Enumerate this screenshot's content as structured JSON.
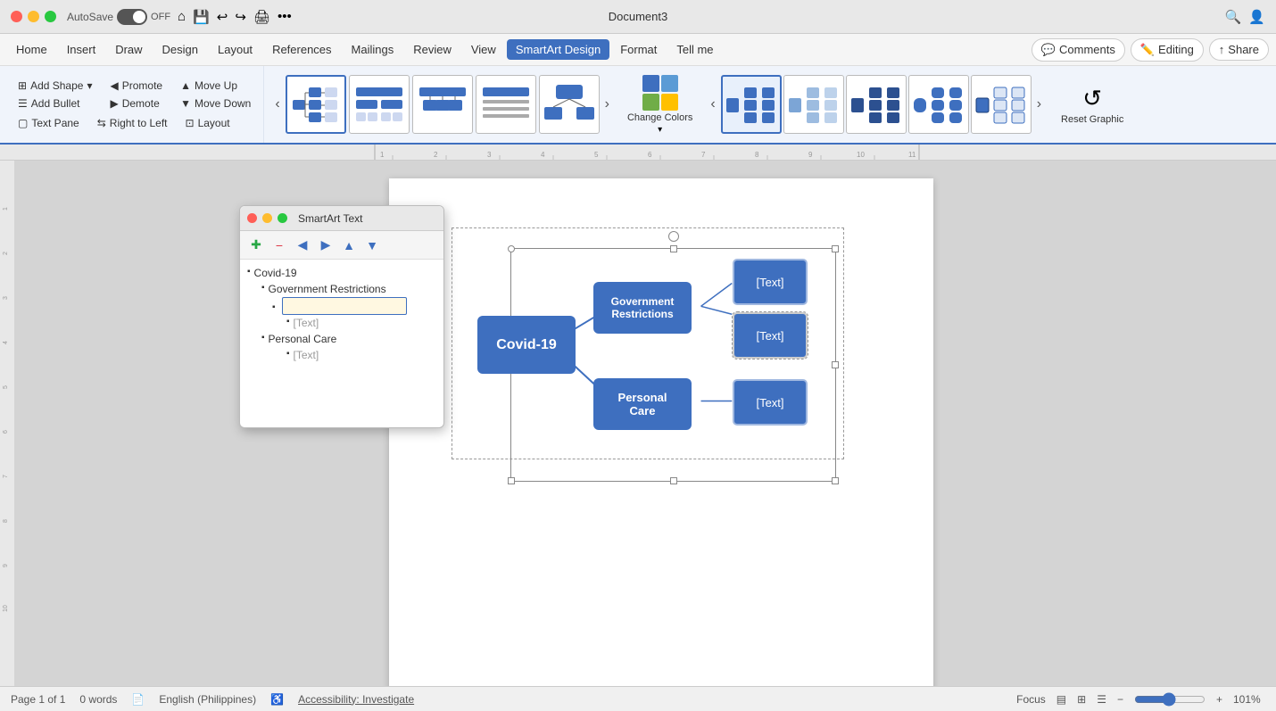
{
  "app": {
    "title": "Document3",
    "autosave_label": "AutoSave",
    "toggle_state": "OFF"
  },
  "titlebar": {
    "icons": [
      "house",
      "save",
      "undo",
      "redo",
      "print",
      "more"
    ]
  },
  "menubar": {
    "items": [
      "Home",
      "Insert",
      "Draw",
      "Design",
      "Layout",
      "References",
      "Mailings",
      "Review",
      "View",
      "SmartArt Design",
      "Format",
      "Tell me"
    ],
    "active": "SmartArt Design",
    "comments_label": "Comments",
    "editing_label": "Editing",
    "share_label": "Share"
  },
  "ribbon": {
    "groups": {
      "shapes": {
        "add_shape_label": "Add Shape",
        "add_bullet_label": "Add Bullet",
        "promote_label": "Promote",
        "demote_label": "Demote",
        "move_up_label": "Move Up",
        "move_down_label": "Move Down",
        "text_pane_label": "Text Pane",
        "right_to_left_label": "Right to Left",
        "layout_label": "Layout"
      },
      "layouts_label": "Layouts",
      "change_colors_label": "Change Colors",
      "reset_graphic_label": "Reset Graphic"
    }
  },
  "smartart_pane": {
    "title": "SmartArt Text",
    "toolbar_buttons": [
      "+",
      "−",
      "←",
      "→",
      "↑",
      "↓"
    ],
    "items": [
      {
        "level": 0,
        "text": "Covid-19"
      },
      {
        "level": 1,
        "text": "Government Restrictions"
      },
      {
        "level": 2,
        "text": ""
      },
      {
        "level": 2,
        "text": "[Text]"
      },
      {
        "level": 1,
        "text": "Personal Care"
      },
      {
        "level": 2,
        "text": "[Text]"
      }
    ]
  },
  "diagram": {
    "center_node": "Covid-19",
    "branches": [
      {
        "mid_label": "Government\nRestrictions",
        "children": [
          "[Text]",
          "[Text]"
        ]
      },
      {
        "mid_label": "Personal\nCare",
        "children": [
          "[Text]"
        ]
      }
    ]
  },
  "statusbar": {
    "page_info": "Page 1 of 1",
    "word_count": "0 words",
    "language": "English (Philippines)",
    "accessibility": "Accessibility: Investigate",
    "focus_label": "Focus",
    "zoom_level": "101%"
  }
}
